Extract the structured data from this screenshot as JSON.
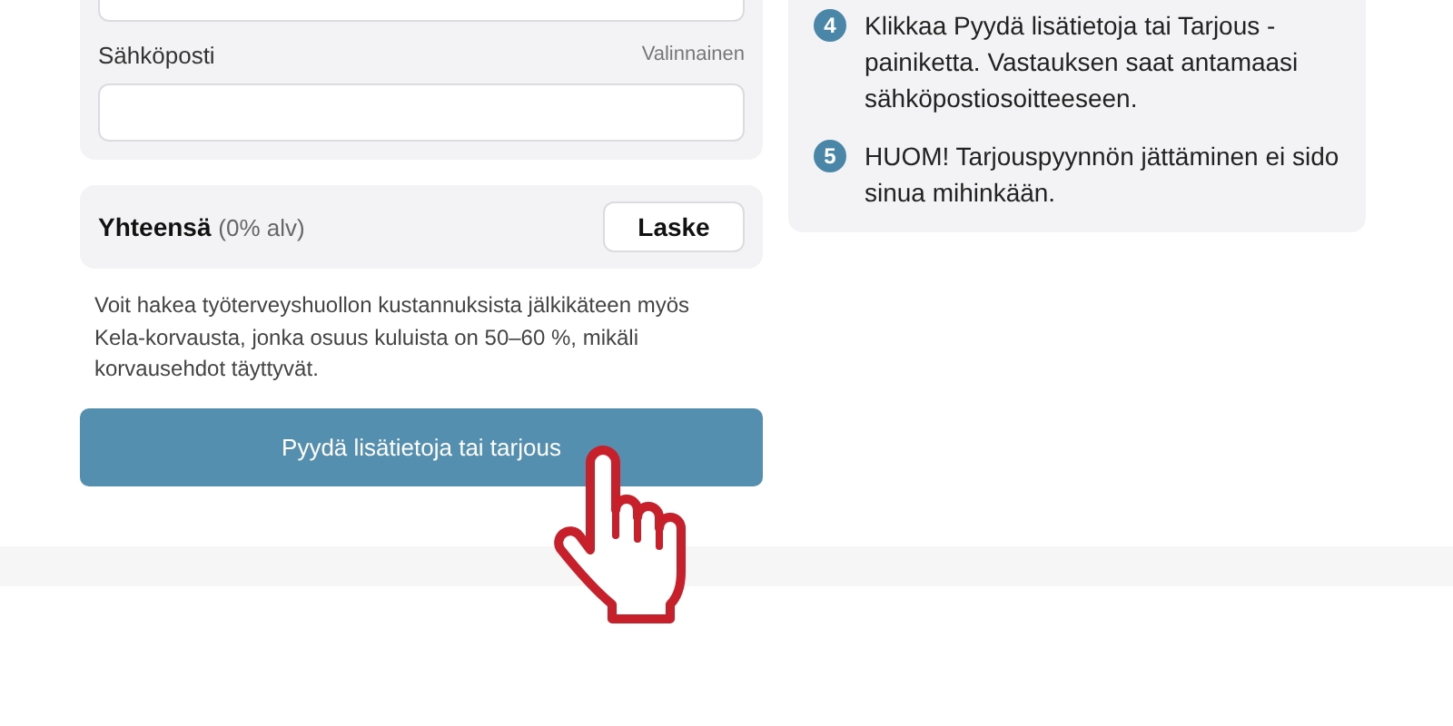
{
  "form": {
    "fields": [
      {
        "kind": "text"
      },
      {
        "kind": "text",
        "label": "Sähköposti",
        "hint": "Valinnainen"
      }
    ],
    "total": {
      "label": "Yhteensä",
      "note": "(0% alv)",
      "button": "Laske"
    },
    "disclaimer": "Voit hakea työterveyshuollon kustannuksista jälkikäteen myös Kela-korvausta, jonka osuus kuluista on 50–60 %, mikäli korvausehdot täyttyvät.",
    "submit_button": "Pyydä lisätietoja tai tarjous"
  },
  "steps": [
    {
      "number": "4",
      "text": "Klikkaa Pyydä lisätietoja tai Tarjous -painiketta. Vastauksen saat antamaasi sähköpostiosoitteeseen."
    },
    {
      "number": "5",
      "text": "HUOM! Tarjouspyynnön jättäminen ei sido sinua mihinkään."
    }
  ]
}
